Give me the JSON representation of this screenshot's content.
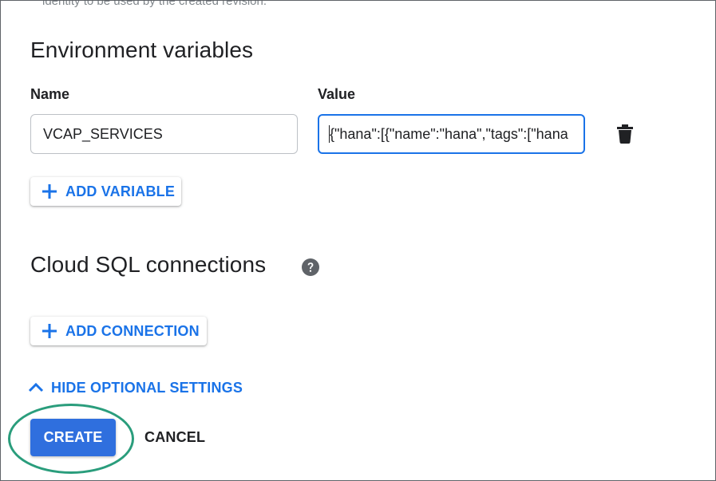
{
  "partial_hint": "identity to be used by the created revision.",
  "env_vars": {
    "title": "Environment variables",
    "name_label": "Name",
    "value_label": "Value",
    "name_value": "VCAP_SERVICES",
    "value_value": "{\"hana\":[{\"name\":\"hana\",\"tags\":[\"hana",
    "add_label": "ADD VARIABLE"
  },
  "cloud_sql": {
    "title": "Cloud SQL connections",
    "add_label": "ADD CONNECTION"
  },
  "toggle_label": "HIDE OPTIONAL SETTINGS",
  "actions": {
    "create_label": "CREATE",
    "cancel_label": "CANCEL"
  },
  "colors": {
    "accent": "#1a73e8",
    "primary_button": "#2f6fde",
    "highlight_ring": "#2a9d7c",
    "icon": "#202124",
    "help_icon": "#5f6368"
  },
  "icons": {
    "delete": "trash-icon",
    "add": "plus-icon",
    "help": "help-icon",
    "collapse": "chevron-up-icon"
  }
}
